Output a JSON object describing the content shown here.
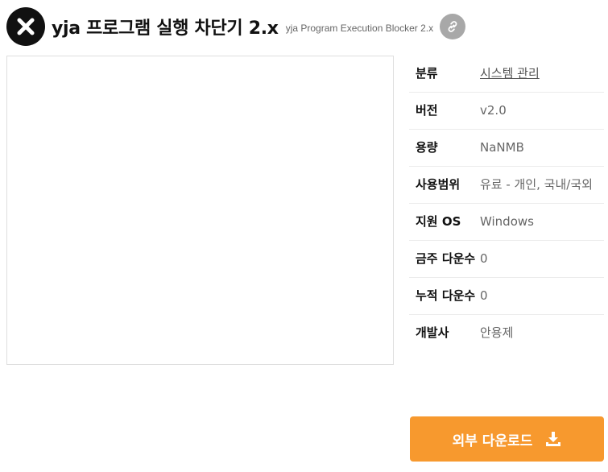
{
  "header": {
    "title": "yja 프로그램 실행 차단기 2.x",
    "subtitle": "yja Program Execution Blocker 2.x",
    "app_icon": "close-x-icon",
    "link_icon": "link-icon"
  },
  "info": {
    "rows": [
      {
        "label": "분류",
        "value": "시스템 관리"
      },
      {
        "label": "버전",
        "value": "v2.0"
      },
      {
        "label": "용량",
        "value": "NaNMB"
      },
      {
        "label": "사용범위",
        "value": "유료 - 개인, 국내/국외"
      },
      {
        "label": "지원 OS",
        "value": "Windows"
      },
      {
        "label": "금주 다운수",
        "value": "0"
      },
      {
        "label": "누적 다운수",
        "value": "0"
      },
      {
        "label": "개발사",
        "value": "안용제"
      }
    ]
  },
  "download": {
    "label": "외부 다운로드",
    "icon": "download-icon",
    "color": "#f7992e"
  }
}
